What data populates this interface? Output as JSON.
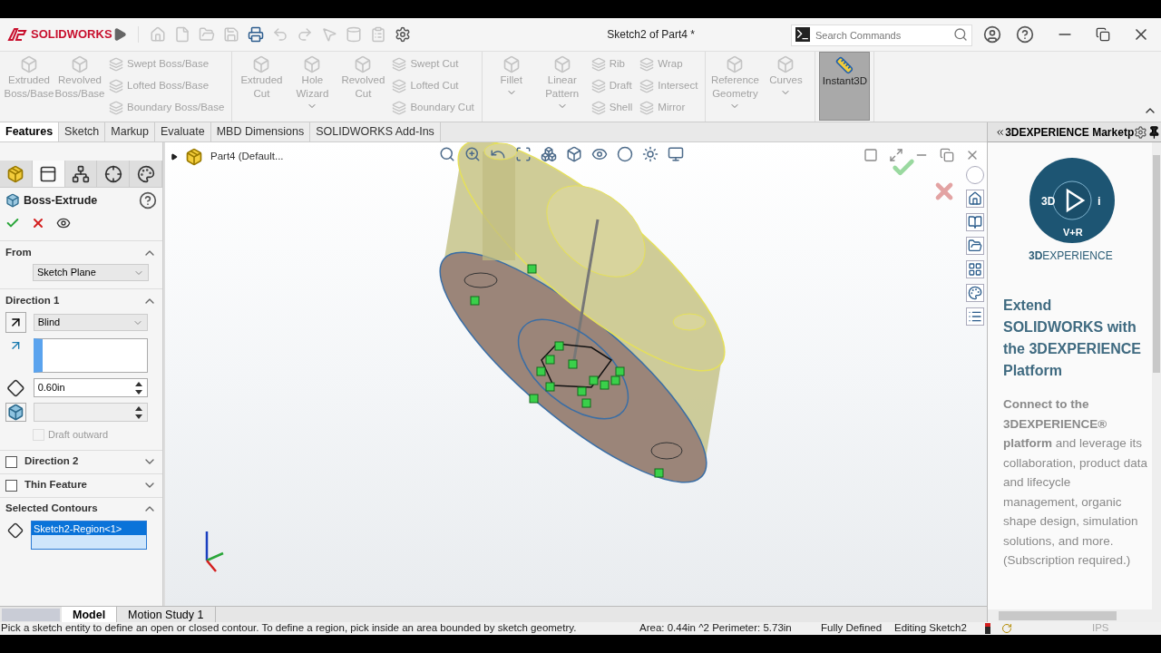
{
  "title_bar": {
    "logo_text": "SOLIDWORKS",
    "document_title": "Sketch2 of Part4 *",
    "search": {
      "placeholder": "Search Commands"
    }
  },
  "ribbon": {
    "groups": [
      {
        "items": [
          {
            "label": "Extruded Boss/Base",
            "kind": "large",
            "disabled": true,
            "on": false
          },
          {
            "label": "Revolved Boss/Base",
            "kind": "large",
            "disabled": true,
            "on": false
          },
          {
            "label": "Swept Boss/Base",
            "kind": "small",
            "disabled": true,
            "on": false
          },
          {
            "label": "Lofted Boss/Base",
            "kind": "small",
            "disabled": true,
            "on": false
          },
          {
            "label": "Boundary Boss/Base",
            "kind": "small",
            "disabled": true,
            "on": false
          }
        ]
      },
      {
        "items": [
          {
            "label": "Extruded Cut",
            "kind": "large",
            "disabled": true,
            "on": false
          },
          {
            "label": "Hole Wizard",
            "kind": "dropdown",
            "disabled": true,
            "on": false
          },
          {
            "label": "Revolved Cut",
            "kind": "large",
            "disabled": true,
            "on": false
          },
          {
            "label": "Swept Cut",
            "kind": "small",
            "disabled": true,
            "on": false
          },
          {
            "label": "Lofted Cut",
            "kind": "small",
            "disabled": true,
            "on": false
          },
          {
            "label": "Boundary Cut",
            "kind": "small",
            "disabled": true,
            "on": false
          }
        ]
      },
      {
        "items": [
          {
            "label": "Fillet",
            "kind": "dropdown",
            "disabled": true,
            "on": false
          },
          {
            "label": "Linear Pattern",
            "kind": "dropdown",
            "disabled": true,
            "on": false
          },
          {
            "label": "Rib",
            "kind": "small",
            "disabled": true,
            "on": false
          },
          {
            "label": "Draft",
            "kind": "small",
            "disabled": true,
            "on": false
          },
          {
            "label": "Shell",
            "kind": "small",
            "disabled": true,
            "on": false
          },
          {
            "label": "Wrap",
            "kind": "small",
            "disabled": true,
            "on": false
          },
          {
            "label": "Intersect",
            "kind": "small",
            "disabled": true,
            "on": false
          },
          {
            "label": "Mirror",
            "kind": "small",
            "disabled": true,
            "on": false
          }
        ]
      },
      {
        "items": [
          {
            "label": "Reference Geometry",
            "kind": "dropdown",
            "disabled": true,
            "on": false
          },
          {
            "label": "Curves",
            "kind": "dropdown",
            "disabled": true,
            "on": false
          }
        ]
      },
      {
        "items": [
          {
            "label": "Instant3D",
            "kind": "large",
            "disabled": false,
            "on": true
          }
        ]
      }
    ]
  },
  "tabs": [
    {
      "label": "Features",
      "selected": true
    },
    {
      "label": "Sketch",
      "selected": false
    },
    {
      "label": "Markup",
      "selected": false
    },
    {
      "label": "Evaluate",
      "selected": false
    },
    {
      "label": "MBD Dimensions",
      "selected": false
    },
    {
      "label": "SOLIDWORKS Add-Ins",
      "selected": false
    }
  ],
  "property_manager": {
    "tabs": [
      {
        "selected": false
      },
      {
        "selected": true
      },
      {
        "selected": false
      },
      {
        "selected": false
      },
      {
        "selected": false
      }
    ],
    "title": "Boss-Extrude",
    "sections": [
      {
        "kind": "from",
        "title": "From",
        "expanded": true,
        "value": "Sketch Plane"
      },
      {
        "kind": "direction",
        "title": "Direction 1",
        "expanded": true,
        "value": "Blind",
        "depth": "0.60in",
        "draft": {
          "label": "Draft outward",
          "checked": false,
          "disabled": true
        }
      },
      {
        "kind": "check",
        "title": "Direction 2",
        "checked": false,
        "expanded": false
      },
      {
        "kind": "check",
        "title": "Thin Feature",
        "checked": false,
        "expanded": false
      },
      {
        "kind": "contours",
        "title": "Selected Contours",
        "expanded": true,
        "items": [
          {
            "label": "Sketch2-Region<1>",
            "selected": true
          }
        ]
      }
    ]
  },
  "tree": {
    "root": {
      "label": "Part4 (Default...",
      "expanded": false
    }
  },
  "marketplace": {
    "header": "3DEXPERIENCE Marketp",
    "logo_marks": [
      "3D",
      "V+R",
      "i"
    ],
    "wordmark": "**3D**EXPERIENCE",
    "heading": "Extend SOLIDWORKS with the 3DEXPERIENCE Platform",
    "body": "**Connect to the 3DEXPERIENCE® platform** and leverage its collaboration, product data and lifecycle management, organic shape design, simulation solutions, and more. (Subscription required.)"
  },
  "bottom_tabs": [
    {
      "label": "Model",
      "selected": true
    },
    {
      "label": "Motion Study 1",
      "selected": false
    }
  ],
  "status_bar": {
    "message": "Pick a sketch entity to define an open or closed contour. To define a region, pick inside an area bounded by sketch geometry.",
    "measure": "Area: 0.44in ^2 Perimeter: 5.73in",
    "sketch_state": "Fully Defined",
    "mode": "Editing Sketch2",
    "units": "IPS"
  }
}
